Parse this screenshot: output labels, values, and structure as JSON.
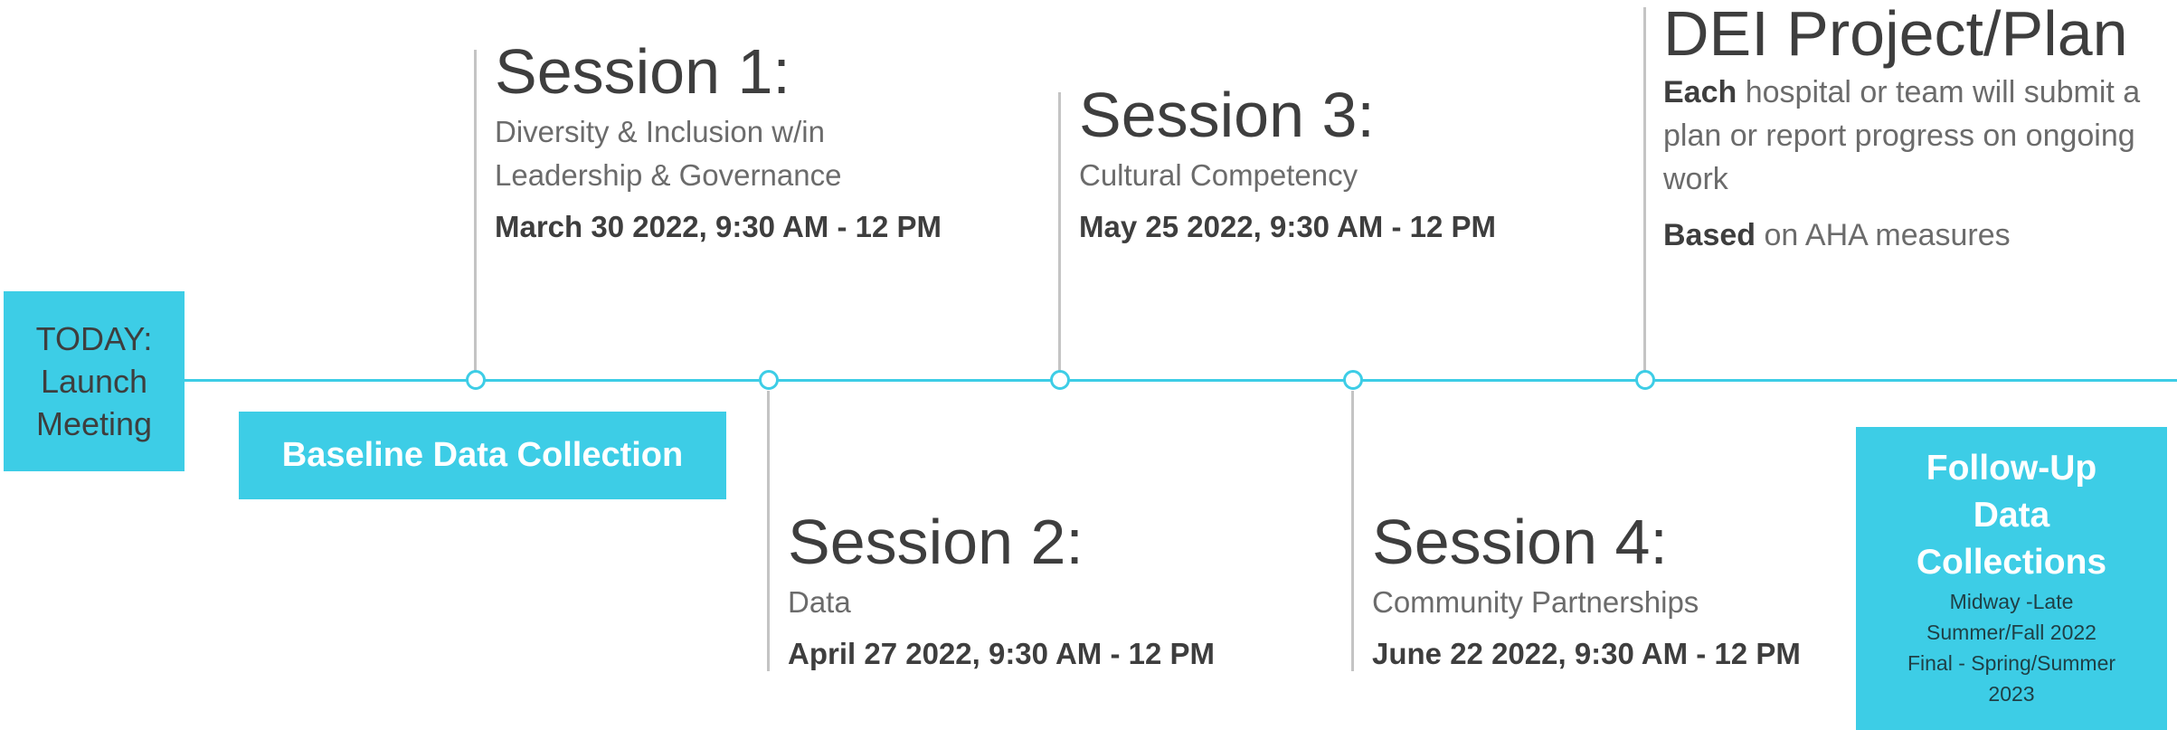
{
  "today_box": {
    "lines": [
      "TODAY:",
      "Launch",
      "Meeting"
    ]
  },
  "baseline_box": {
    "label": "Baseline Data Collection"
  },
  "sessions": [
    {
      "title": "Session 1:",
      "subtitle_lines": [
        "Diversity & Inclusion w/in",
        "Leadership & Governance"
      ],
      "date": "March 30 2022, 9:30 AM - 12 PM"
    },
    {
      "title": "Session 2:",
      "subtitle_lines": [
        "Data"
      ],
      "date": "April 27 2022, 9:30 AM - 12 PM"
    },
    {
      "title": "Session 3:",
      "subtitle_lines": [
        "Cultural Competency"
      ],
      "date": "May 25 2022, 9:30 AM - 12 PM"
    },
    {
      "title": "Session 4:",
      "subtitle_lines": [
        "Community Partnerships"
      ],
      "date": "June 22 2022, 9:30 AM - 12 PM"
    }
  ],
  "dei": {
    "title": "DEI Project/Plan",
    "line1_bold": "Each",
    "line1_rest": " hospital or team will submit a",
    "line2": "plan or report progress on ongoing",
    "line3": "work",
    "line4_bold": "Based",
    "line4_rest": " on AHA measures"
  },
  "followup_box": {
    "title_lines": [
      "Follow-Up",
      "Data",
      "Collections"
    ],
    "detail_lines": [
      "Midway -Late",
      "Summer/Fall 2022",
      "Final - Spring/Summer",
      "2023"
    ]
  },
  "colors": {
    "accent": "#3dcde6",
    "text_dark": "#3e3e3e",
    "text_mid": "#6b6b6b",
    "connector": "#c4c4c4"
  }
}
